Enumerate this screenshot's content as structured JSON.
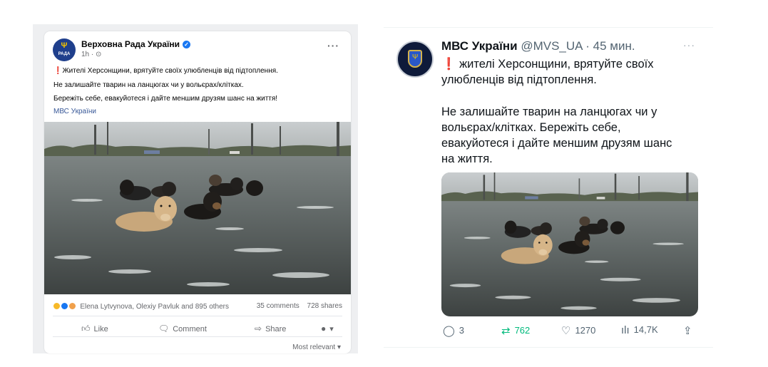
{
  "facebook_post": {
    "author": "Верховна Рада України",
    "avatar_text": "РАДА",
    "meta": "1h · ⊙",
    "text_lines": [
      "Жителі Херсонщини, врятуйте своїх улюбленців від підтоплення.",
      "Не залишайте тварин на ланцюгах чи у вольєрах/клітках.",
      "Бережіть себе, евакуйотеся і дайте меншим друзям шанс на життя!"
    ],
    "linked_page": "МВС України",
    "reactions_text": "Elena Lytvynova, Olexiy Pavluk and 895 others",
    "comments": "35 comments",
    "shares": "728 shares",
    "actions": {
      "like": "Like",
      "comment": "Comment",
      "share": "Share"
    },
    "sort_label": "Most relevant ▾"
  },
  "tweet": {
    "name": "МВС України",
    "handle": "@MVS_UA · 45 мин.",
    "text_lines": [
      "жителі Херсонщини, врятуйте своїх",
      "улюбленців від підтоплення.",
      "Не залишайте тварин на ланцюгах чи у",
      "вольєрах/клітках. Бережіть себе,",
      "евакуйотеся і дайте меншим друзям шанс",
      "на життя."
    ],
    "stats": {
      "replies": "3",
      "retweets": "762",
      "likes": "1270",
      "views": "14,7K"
    }
  },
  "colors": {
    "facebook_blue": "#1877f2",
    "retweet_green": "#00ba7c",
    "alert_red": "#e0232e"
  },
  "icons": [
    "verified-icon",
    "more-icon",
    "like-icon",
    "comment-icon",
    "share-icon",
    "reply-icon",
    "retweet-icon",
    "heart-icon",
    "views-icon",
    "upload-icon"
  ]
}
